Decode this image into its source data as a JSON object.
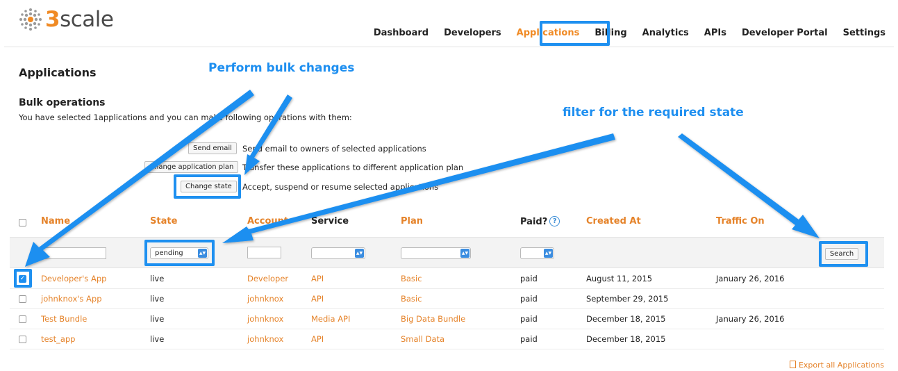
{
  "brand": {
    "logo_prefix": "3",
    "logo_rest": "scale",
    "accent": "#f08a24",
    "annotation_color": "#1e8ff0"
  },
  "nav": [
    {
      "label": "Dashboard",
      "active": false
    },
    {
      "label": "Developers",
      "active": false
    },
    {
      "label": "Applications",
      "active": true
    },
    {
      "label": "Billing",
      "active": false
    },
    {
      "label": "Analytics",
      "active": false
    },
    {
      "label": "APIs",
      "active": false
    },
    {
      "label": "Developer Portal",
      "active": false
    },
    {
      "label": "Settings",
      "active": false
    }
  ],
  "page": {
    "title": "Applications"
  },
  "bulk": {
    "title": "Bulk operations",
    "description": "You have selected 1applications and you can make following operations with them:",
    "operations": [
      {
        "button": "Send email",
        "description": "Send email to owners of selected applications"
      },
      {
        "button": "Change application plan",
        "description": "Transfer these applications to different application plan"
      },
      {
        "button": "Change state",
        "description": "Accept, suspend or resume selected applications"
      }
    ]
  },
  "table": {
    "headers": {
      "name": "Name",
      "state": "State",
      "account": "Account",
      "service": "Service",
      "plan": "Plan",
      "paid": "Paid?",
      "created_at": "Created At",
      "traffic_on": "Traffic On"
    },
    "help_icon": "?",
    "filters": {
      "state": "pending",
      "search_label": "Search"
    },
    "rows": [
      {
        "checked": true,
        "name": "Developer's App",
        "state": "live",
        "account": "Developer",
        "service": "API",
        "plan": "Basic",
        "paid": "paid",
        "created_at": "August 11, 2015",
        "traffic_on": "January 26, 2016"
      },
      {
        "checked": false,
        "name": "johnknox's App",
        "state": "live",
        "account": "johnknox",
        "service": "API",
        "plan": "Basic",
        "paid": "paid",
        "created_at": "September 29, 2015",
        "traffic_on": ""
      },
      {
        "checked": false,
        "name": "Test Bundle",
        "state": "live",
        "account": "johnknox",
        "service": "Media API",
        "plan": "Big Data Bundle",
        "paid": "paid",
        "created_at": "December 18, 2015",
        "traffic_on": "January 26, 2016"
      },
      {
        "checked": false,
        "name": "test_app",
        "state": "live",
        "account": "johnknox",
        "service": "API",
        "plan": "Small Data",
        "paid": "paid",
        "created_at": "December 18, 2015",
        "traffic_on": ""
      }
    ]
  },
  "export": {
    "label": "Export all Applications",
    "icon": "spreadsheet-icon"
  },
  "annotations": {
    "bulk": "Perform bulk changes",
    "filter": "filter for the required state"
  }
}
